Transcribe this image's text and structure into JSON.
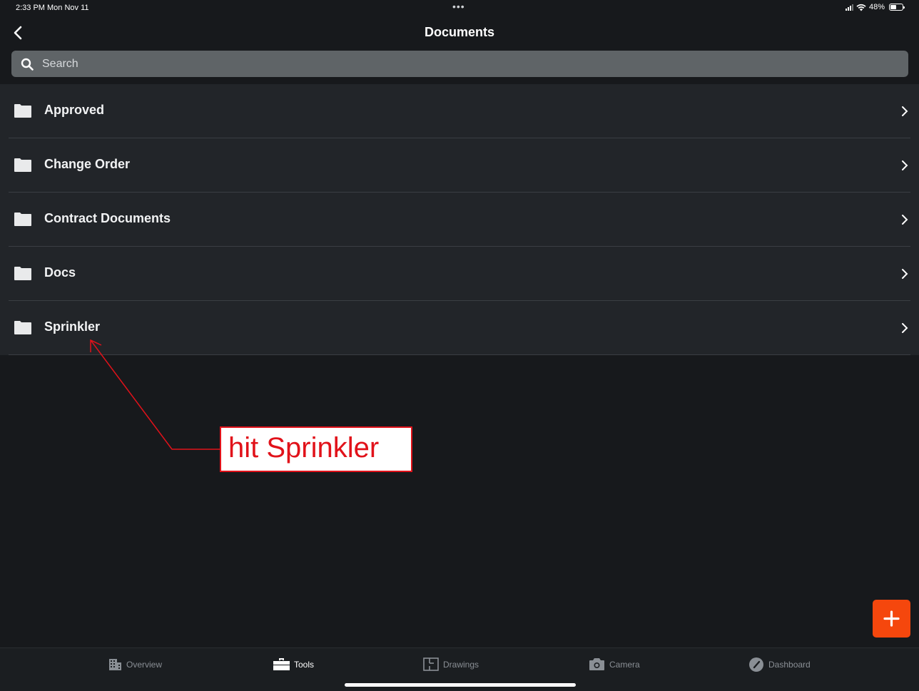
{
  "status_bar": {
    "time": "2:33 PM  Mon Nov 11",
    "dots": "•••",
    "battery_percent": "48%",
    "battery_level": 0.48
  },
  "nav": {
    "title": "Documents"
  },
  "search": {
    "placeholder": "Search"
  },
  "folders": [
    {
      "label": "Approved"
    },
    {
      "label": "Change Order"
    },
    {
      "label": "Contract Documents"
    },
    {
      "label": "Docs"
    },
    {
      "label": "Sprinkler"
    }
  ],
  "annotation": {
    "text": "hit Sprinkler",
    "color": "#e1121a"
  },
  "fab": {
    "icon": "plus-icon",
    "color": "#f5470d"
  },
  "tabbar": {
    "tabs": [
      {
        "label": "Overview",
        "icon": "building-icon",
        "active": false
      },
      {
        "label": "Tools",
        "icon": "toolbox-icon",
        "active": true
      },
      {
        "label": "Drawings",
        "icon": "floorplan-icon",
        "active": false
      },
      {
        "label": "Camera",
        "icon": "camera-icon",
        "active": false
      },
      {
        "label": "Dashboard",
        "icon": "gauge-icon",
        "active": false
      }
    ]
  }
}
